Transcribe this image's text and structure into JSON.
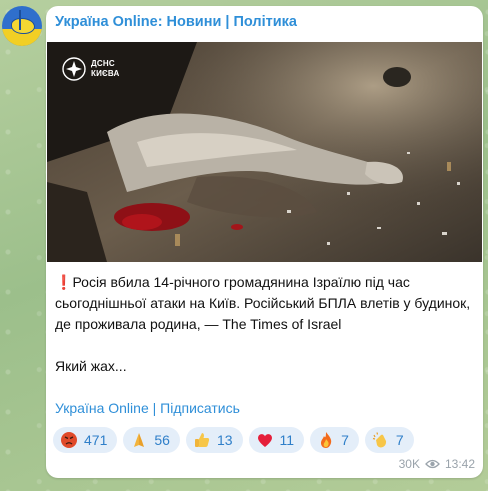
{
  "channel": {
    "title": "Україна Online: Новини | Політика"
  },
  "photo": {
    "watermark_line1": "ДСНС",
    "watermark_line2": "КИЄВА"
  },
  "message": {
    "alert_mark": "❗",
    "line1": "Росія вбила 14-річного громадянина Ізраїлю під час сьогоднішньої атаки на Київ. Російський БПЛА влетів у будинок, де проживала родина, — The Times of Israel",
    "line2": "Який жах...",
    "signature": "Україна Online | Підписатись"
  },
  "reactions": [
    {
      "emoji": "angry-face-icon",
      "count": "471"
    },
    {
      "emoji": "praying-hands-icon",
      "count": "56"
    },
    {
      "emoji": "thumbs-up-icon",
      "count": "13"
    },
    {
      "emoji": "heart-icon",
      "count": "11"
    },
    {
      "emoji": "fire-icon",
      "count": "7"
    },
    {
      "emoji": "clapping-hands-icon",
      "count": "7"
    }
  ],
  "meta": {
    "views": "30K",
    "time": "13:42"
  },
  "colors": {
    "accent": "#2f8fd8",
    "reaction_bg": "#e4eef9",
    "alert": "#d8262a"
  }
}
